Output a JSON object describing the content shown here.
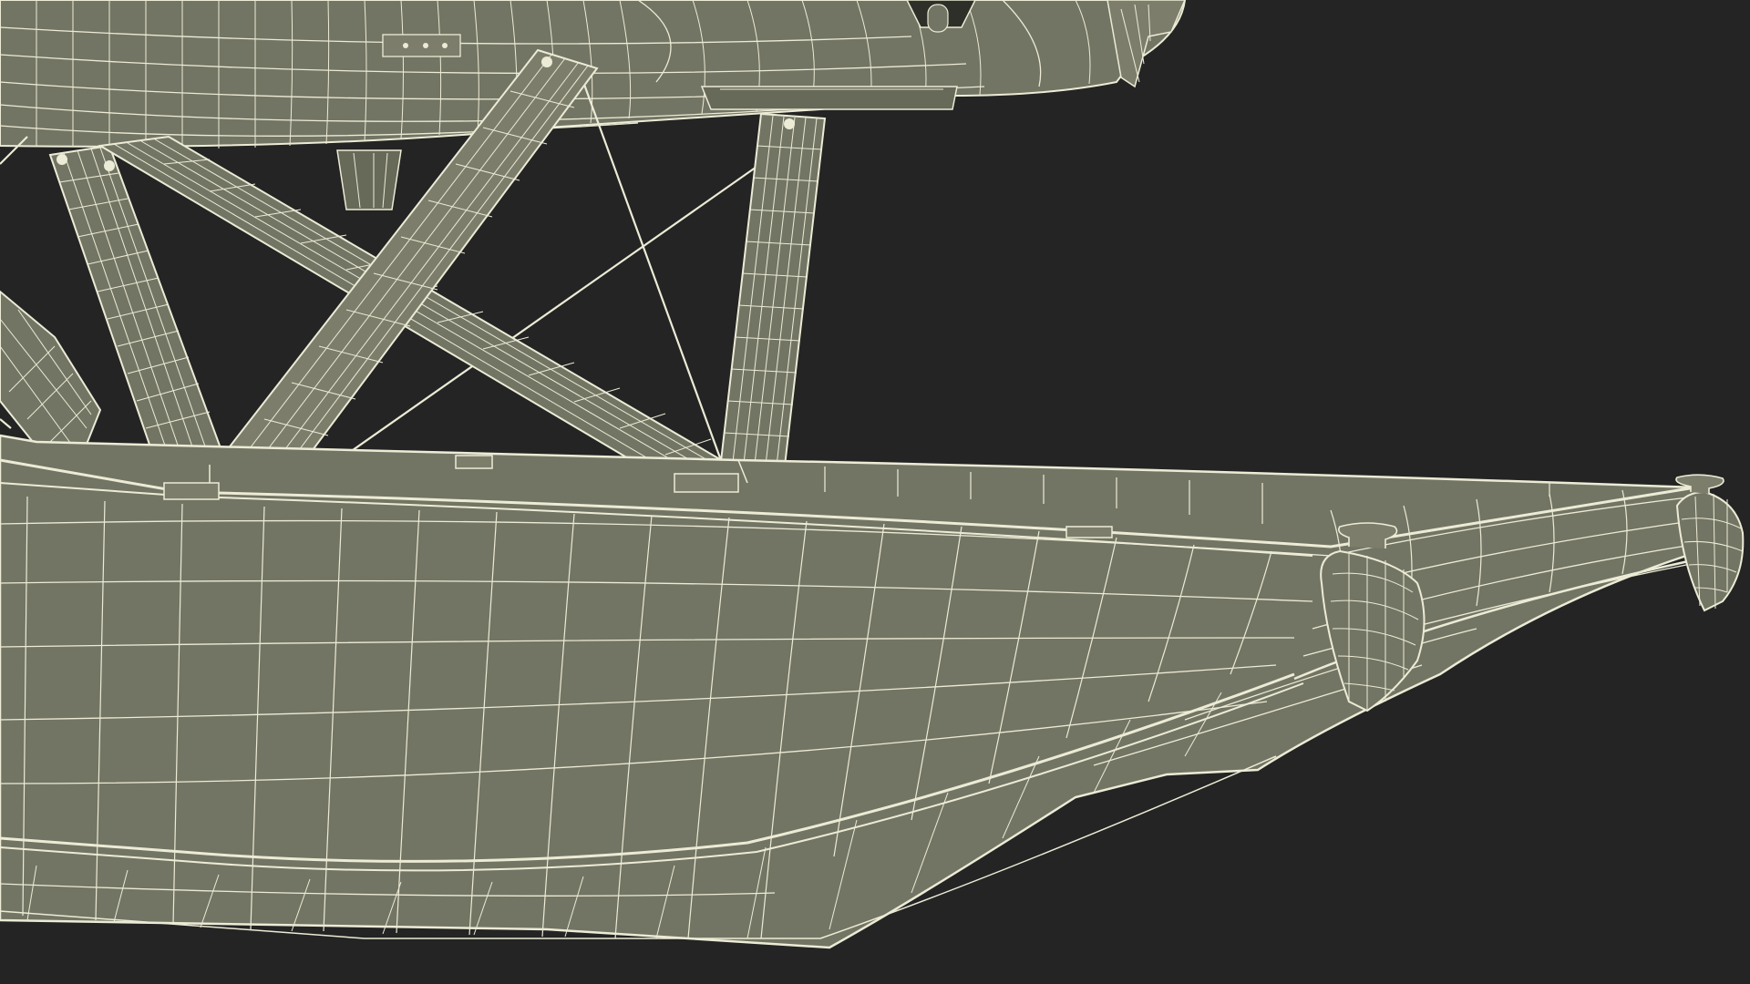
{
  "scene": {
    "subject": "",
    "colors": {
      "background": "#242424",
      "surface": "#737564",
      "surface_light": "#7c7e6b",
      "surface_dark": "#676959",
      "wire": "#ecebd6"
    }
  }
}
